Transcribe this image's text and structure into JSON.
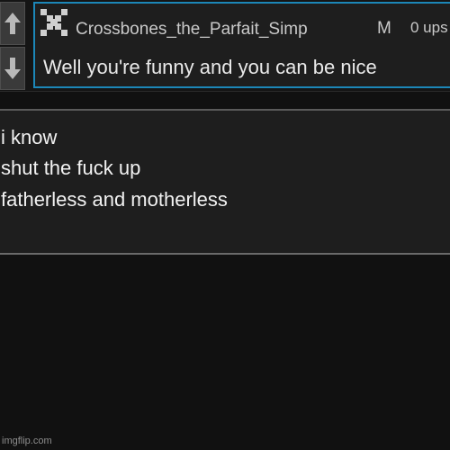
{
  "comment": {
    "username": "Crossbones_the_Parfait_Simp",
    "gender": "M",
    "upvotes": "0 ups",
    "text": "Well you're funny and you can be nice",
    "avatar_icon": "pixel-cross-avatar",
    "upvote_icon": "up-arrow-icon",
    "downvote_icon": "down-arrow-icon",
    "highlight_color": "#1c87b8"
  },
  "reply": {
    "lines": [
      "i know",
      "shut the fuck up",
      "fatherless and motherless"
    ]
  },
  "watermark": "imgflip.com"
}
